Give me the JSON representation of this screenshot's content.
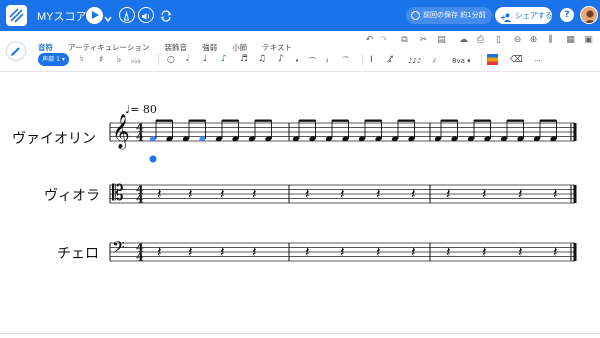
{
  "app": {
    "title": "MYスコア",
    "save_status": "前回の保存 約1分前",
    "share_label": "シェアする",
    "help_label": "?"
  },
  "colors": {
    "primary": "#1a73e8",
    "selected_note": "#4285f4",
    "cursor": "#1a73e8"
  },
  "topbar_icons": [
    "logo-icon",
    "play-icon",
    "chevron-down-icon",
    "metronome-icon",
    "volume-icon",
    "loop-icon",
    "clock-icon",
    "add-person-icon",
    "help-icon",
    "avatar"
  ],
  "toolbar": {
    "tabs": [
      {
        "label": "音符",
        "active": true
      },
      {
        "label": "アーティキュレーション",
        "active": false
      },
      {
        "label": "装飾音",
        "active": false
      },
      {
        "label": "強弱",
        "active": false
      },
      {
        "label": "小節",
        "active": false
      },
      {
        "label": "テキスト",
        "active": false
      }
    ],
    "voice_label": "声部 1",
    "accidentals": [
      "♮",
      "♯",
      "♭",
      "♭♭♭"
    ],
    "durations": [
      "𝅝",
      "𝅗𝅥",
      "♩",
      "♪",
      "𝅘𝅥𝅯",
      "𝅘𝅥𝅰"
    ],
    "more_label": "···"
  },
  "score": {
    "tempo_mark": "♩",
    "tempo_value": "= 80",
    "instruments": [
      {
        "name": "ヴァイオリン",
        "clef": "treble-clef"
      },
      {
        "name": "ヴィオラ",
        "clef": "alto-clef"
      },
      {
        "name": "チェロ",
        "clef": "bass-clef"
      }
    ],
    "time_signature": {
      "numerator": "4",
      "denominator": "4"
    },
    "measures_per_staff": 3,
    "violin_eighth_notes_per_measure": 8,
    "lower_staves_rests_per_measure": 4
  }
}
